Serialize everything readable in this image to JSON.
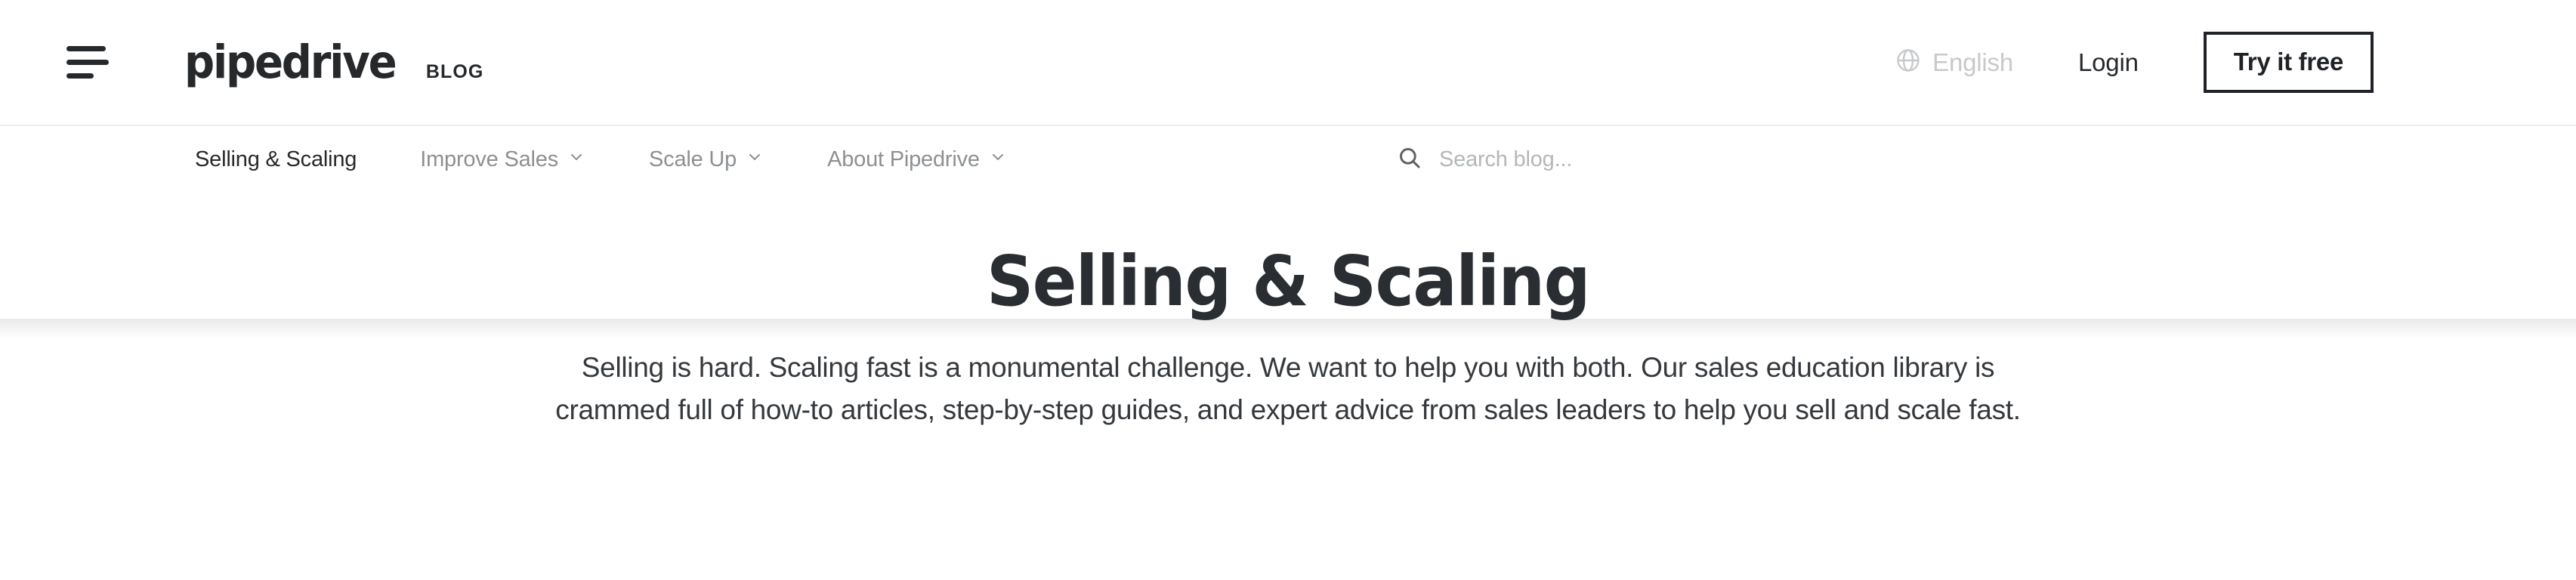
{
  "header": {
    "menu_icon": "hamburger-menu-icon",
    "logo_word": "pipedrive",
    "logo_tag": "BLOG",
    "language": {
      "icon": "globe-icon",
      "label": "English"
    },
    "login_label": "Login",
    "cta_label": "Try it free"
  },
  "subnav": {
    "items": [
      {
        "label": "Selling & Scaling",
        "active": true,
        "has_dropdown": false
      },
      {
        "label": "Improve Sales",
        "active": false,
        "has_dropdown": true
      },
      {
        "label": "Scale Up",
        "active": false,
        "has_dropdown": true
      },
      {
        "label": "About Pipedrive",
        "active": false,
        "has_dropdown": true
      }
    ],
    "search": {
      "icon": "search-icon",
      "placeholder": "Search blog...",
      "value": ""
    }
  },
  "hero": {
    "title": "Selling & Scaling",
    "subtitle": "Selling is hard. Scaling fast is a monumental challenge. We want to help you with both. Our sales education library is crammed full of how-to articles, step-by-step guides, and expert advice from sales leaders to help you sell and scale fast."
  },
  "colors": {
    "ink": "#26292c",
    "muted": "#8d9093",
    "placeholder": "#b4b7b9",
    "hairline": "#eceded",
    "page_bg": "#ffffff"
  }
}
